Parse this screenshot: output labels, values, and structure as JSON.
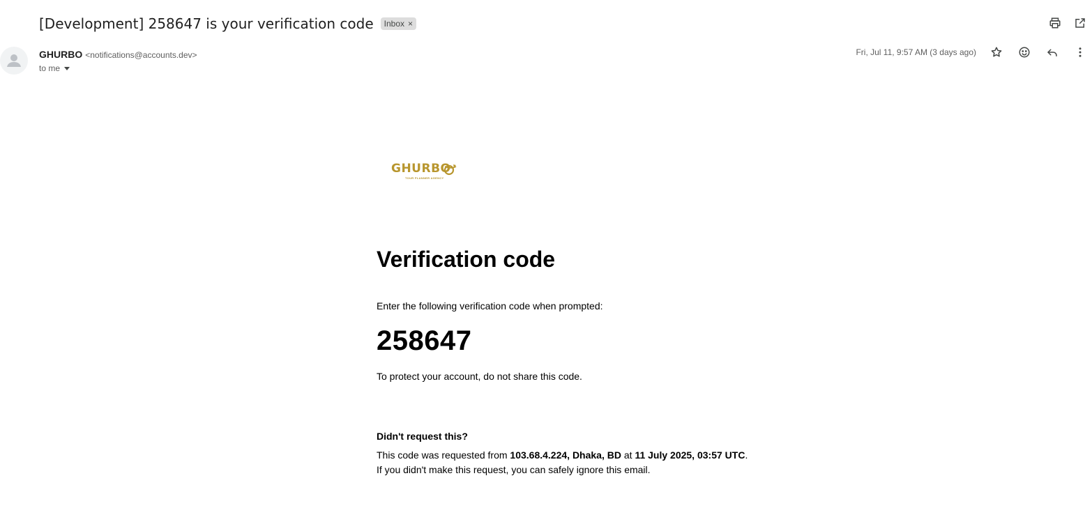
{
  "email": {
    "subject": "[Development] 258647 is your verification code",
    "label": "Inbox",
    "label_close": "×",
    "sender": {
      "name": "GHURBO",
      "email": "<notifications@accounts.dev>"
    },
    "recipient_label": "to me",
    "date": "Fri, Jul 11, 9:57 AM (3 days ago)"
  },
  "toolbar_icons": [
    "print-icon",
    "open-in-new-window-icon",
    "star-icon",
    "emoji-reaction-icon",
    "reply-icon",
    "more-options-icon"
  ],
  "body": {
    "logo_text": "GHURBO",
    "logo_tagline": "TOUR PLANNER AGENCY",
    "heading": "Verification code",
    "instruction": "Enter the following verification code when prompted:",
    "code": "258647",
    "warning": "To protect your account, do not share this code.",
    "didnt_request_heading": "Didn't request this?",
    "request_prefix": "This code was requested from ",
    "request_location": "103.68.4.224, Dhaka, BD",
    "request_at": " at ",
    "request_time": "11 July 2025, 03:57 UTC",
    "request_suffix": ".",
    "ignore_text": "If you didn't make this request, you can safely ignore this email."
  },
  "colors": {
    "logo_gold": "#b8962e",
    "chip_bg": "#dddddd",
    "muted_text": "#5e5e5e"
  }
}
